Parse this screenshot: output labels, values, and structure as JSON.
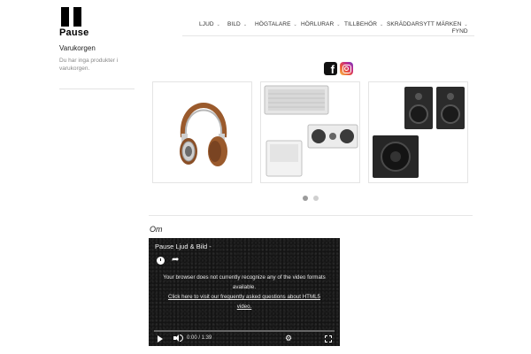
{
  "brand": {
    "name": "Pause"
  },
  "nav": {
    "items": [
      {
        "label": "LJUD",
        "has_dropdown": true
      },
      {
        "label": "BILD",
        "has_dropdown": true
      },
      {
        "label": "HÖGTALARE",
        "has_dropdown": true
      },
      {
        "label": "HÖRLURAR",
        "has_dropdown": true
      },
      {
        "label": "TILLBEHÖR",
        "has_dropdown": true
      },
      {
        "label": "SKRÄDDARSYTT",
        "has_dropdown": false
      },
      {
        "label": "MÄRKEN",
        "label2": "FYND",
        "has_dropdown": true
      }
    ]
  },
  "sidebar": {
    "cart_title": "Varukorgen",
    "cart_empty_text": "Du har inga produkter i varukorgen."
  },
  "social": {
    "icons": [
      "facebook-icon",
      "instagram-icon"
    ]
  },
  "carousel": {
    "slides": [
      "headphones",
      "white speaker set",
      "black speaker set"
    ],
    "dot_count": 2,
    "active_dot": 1
  },
  "about": {
    "heading": "Om"
  },
  "video": {
    "title": "Pause Ljud & Bild -",
    "message": "Your browser does not currently recognize any of the video formats available.",
    "link_text": "Click here to visit our frequently asked questions about HTML5 video.",
    "time": "0:00 / 1:39"
  },
  "colors": {
    "text": "#222222",
    "divider": "#e6e6e6",
    "video_bg": "#141414"
  }
}
